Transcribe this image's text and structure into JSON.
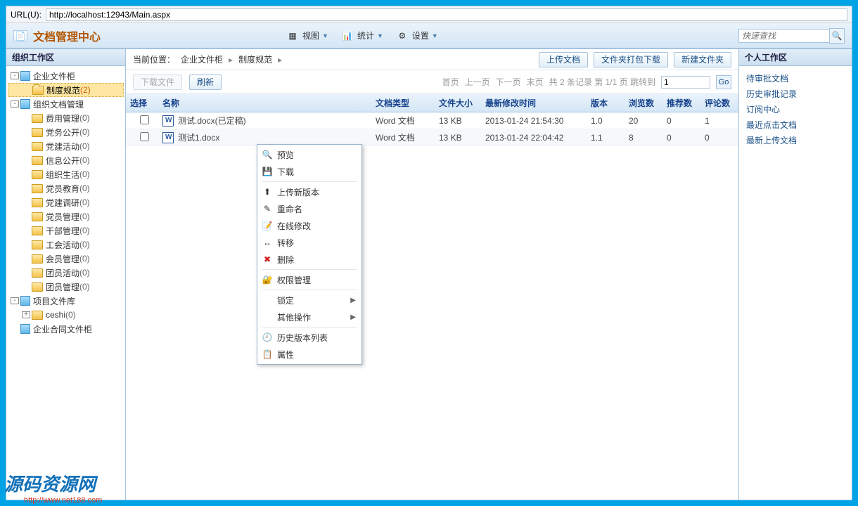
{
  "url_label": "URL(U):",
  "url_value": "http://localhost:12943/Main.aspx",
  "app_title": "文档管理中心",
  "header_menus": [
    {
      "label": "视图"
    },
    {
      "label": "统计"
    },
    {
      "label": "设置"
    }
  ],
  "search_placeholder": "快速查找",
  "left_panel_title": "组织工作区",
  "tree": {
    "root1": {
      "label": "企业文件柜"
    },
    "root1_children": [
      {
        "label": "制度规范",
        "count": "(2)",
        "selected": true
      }
    ],
    "root2": {
      "label": "组织文档管理"
    },
    "root2_children": [
      {
        "label": "费用管理",
        "count": "(0)"
      },
      {
        "label": "党务公开",
        "count": "(0)"
      },
      {
        "label": "党建活动",
        "count": "(0)"
      },
      {
        "label": "信息公开",
        "count": "(0)"
      },
      {
        "label": "组织生活",
        "count": "(0)"
      },
      {
        "label": "党员教育",
        "count": "(0)"
      },
      {
        "label": "党建调研",
        "count": "(0)"
      },
      {
        "label": "党员管理",
        "count": "(0)"
      },
      {
        "label": "干部管理",
        "count": "(0)"
      },
      {
        "label": "工会活动",
        "count": "(0)"
      },
      {
        "label": "会员管理",
        "count": "(0)"
      },
      {
        "label": "团员活动",
        "count": "(0)"
      },
      {
        "label": "团员管理",
        "count": "(0)"
      }
    ],
    "root3": {
      "label": "项目文件库"
    },
    "root3_children": [
      {
        "label": "ceshi",
        "count": "(0)"
      }
    ],
    "root4": {
      "label": "企业合同文件柜"
    }
  },
  "breadcrumb": {
    "label": "当前位置：",
    "p1": "企业文件柜",
    "p2": "制度规范"
  },
  "top_buttons": {
    "upload": "上传文档",
    "zip": "文件夹打包下载",
    "newfolder": "新建文件夹"
  },
  "toolbar": {
    "download": "下载文件",
    "refresh": "刷新"
  },
  "pager": {
    "first": "首页",
    "prev": "上一页",
    "next": "下一页",
    "last": "末页",
    "info": "共 2 条记录 第 1/1 页 跳转到",
    "val": "1",
    "go": "Go"
  },
  "columns": {
    "sel": "选择",
    "name": "名称",
    "type": "文档类型",
    "size": "文件大小",
    "time": "最新修改时间",
    "ver": "版本",
    "view": "浏览数",
    "rec": "推荐数",
    "com": "评论数"
  },
  "rows": [
    {
      "name": "测试.docx(已定稿)",
      "type": "Word 文档",
      "size": "13 KB",
      "time": "2013-01-24 21:54:30",
      "ver": "1.0",
      "view": "20",
      "rec": "0",
      "com": "1"
    },
    {
      "name": "测试1.docx",
      "type": "Word 文档",
      "size": "13 KB",
      "time": "2013-01-24 22:04:42",
      "ver": "1.1",
      "view": "8",
      "rec": "0",
      "com": "0"
    }
  ],
  "right_panel_title": "个人工作区",
  "right_links": [
    "待审批文档",
    "历史审批记录",
    "订阅中心",
    "最近点击文档",
    "最新上传文档"
  ],
  "context_menu": [
    {
      "label": "预览",
      "icon": "🔍"
    },
    {
      "label": "下载",
      "icon": "💾"
    },
    {
      "sep": true
    },
    {
      "label": "上传新版本",
      "icon": "⬆"
    },
    {
      "label": "重命名",
      "icon": "✎"
    },
    {
      "label": "在线修改",
      "icon": "📝"
    },
    {
      "label": "转移",
      "icon": "↔"
    },
    {
      "label": "删除",
      "icon": "✖",
      "iconColor": "#d02020"
    },
    {
      "sep": true
    },
    {
      "label": "权限管理",
      "icon": "🔐"
    },
    {
      "sep": true
    },
    {
      "label": "锁定",
      "sub": true
    },
    {
      "label": "其他操作",
      "sub": true
    },
    {
      "sep": true
    },
    {
      "label": "历史版本列表",
      "icon": "🕘"
    },
    {
      "label": "属性",
      "icon": "📋"
    }
  ],
  "watermark": {
    "line1": "源码资源网",
    "line2": "http://www.net188.com"
  }
}
